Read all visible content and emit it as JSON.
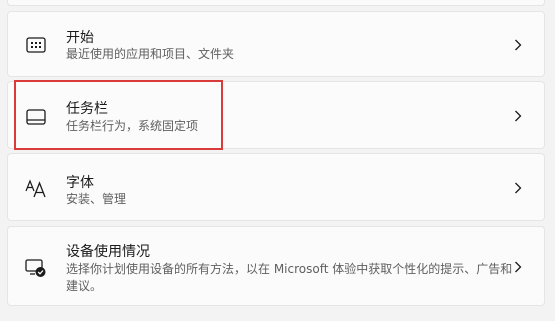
{
  "settings": {
    "items": [
      {
        "title": "开始",
        "subtitle": "最近使用的应用和项目、文件夹",
        "icon": "start-menu-icon"
      },
      {
        "title": "任务栏",
        "subtitle": "任务栏行为，系统固定项",
        "icon": "taskbar-icon"
      },
      {
        "title": "字体",
        "subtitle": "安装、管理",
        "icon": "fonts-icon"
      },
      {
        "title": "设备使用情况",
        "subtitle": "选择你计划使用设备的所有方法，以在 Microsoft 体验中获取个性化的提示、广告和建议。",
        "icon": "device-usage-icon"
      }
    ]
  },
  "colors": {
    "highlight": "#d93b3b",
    "card_bg": "#fbfbfb",
    "page_bg": "#f3f3f3"
  }
}
